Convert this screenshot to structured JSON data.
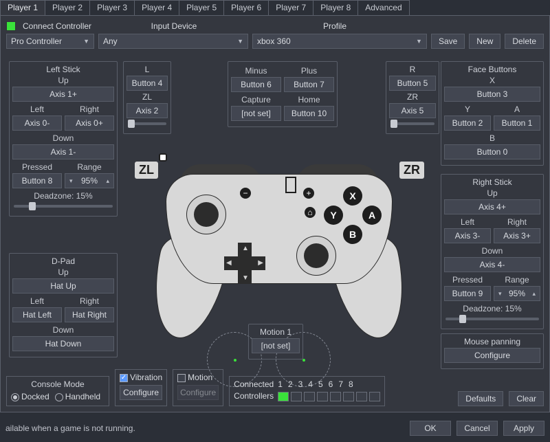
{
  "tabs": [
    "Player 1",
    "Player 2",
    "Player 3",
    "Player 4",
    "Player 5",
    "Player 6",
    "Player 7",
    "Player 8",
    "Advanced"
  ],
  "active_tab": 0,
  "connect_label": "Connect Controller",
  "input_device_label": "Input Device",
  "profile_label": "Profile",
  "controller_type": "Pro Controller",
  "input_device": "Any",
  "profile": "xbox 360",
  "profile_buttons": {
    "save": "Save",
    "new": "New",
    "delete": "Delete"
  },
  "left_stick": {
    "title": "Left Stick",
    "up_label": "Up",
    "up": "Axis 1+",
    "left_label": "Left",
    "left": "Axis 0-",
    "right_label": "Right",
    "right": "Axis 0+",
    "down_label": "Down",
    "down": "Axis 1-",
    "pressed_label": "Pressed",
    "pressed": "Button 8",
    "range_label": "Range",
    "range": "95%",
    "deadzone_label": "Deadzone: 15%"
  },
  "l_group": {
    "l_label": "L",
    "l": "Button 4",
    "zl_label": "ZL",
    "zl": "Axis 2"
  },
  "center_buttons": {
    "minus_label": "Minus",
    "minus": "Button 6",
    "plus_label": "Plus",
    "plus": "Button 7",
    "capture_label": "Capture",
    "capture": "[not set]",
    "home_label": "Home",
    "home": "Button 10"
  },
  "r_group": {
    "r_label": "R",
    "r": "Button 5",
    "zr_label": "ZR",
    "zr": "Axis 5"
  },
  "face": {
    "title": "Face Buttons",
    "x_label": "X",
    "x": "Button 3",
    "y_label": "Y",
    "y": "Button 2",
    "a_label": "A",
    "a": "Button 1",
    "b_label": "B",
    "b": "Button 0"
  },
  "right_stick": {
    "title": "Right Stick",
    "up_label": "Up",
    "up": "Axis 4+",
    "left_label": "Left",
    "left": "Axis 3-",
    "right_label": "Right",
    "right": "Axis 3+",
    "down_label": "Down",
    "down": "Axis 4-",
    "pressed_label": "Pressed",
    "pressed": "Button 9",
    "range_label": "Range",
    "range": "95%",
    "deadzone_label": "Deadzone: 15%"
  },
  "mouse_panning": {
    "title": "Mouse panning",
    "configure": "Configure"
  },
  "dpad": {
    "title": "D-Pad",
    "up_label": "Up",
    "up": "Hat Up",
    "left_label": "Left",
    "left": "Hat Left",
    "right_label": "Right",
    "right": "Hat Right",
    "down_label": "Down",
    "down": "Hat Down"
  },
  "zl_badge": "ZL",
  "zr_badge": "ZR",
  "motion": {
    "title": "Motion 1",
    "bind": "[not set]"
  },
  "console_mode": {
    "title": "Console Mode",
    "docked": "Docked",
    "handheld": "Handheld",
    "selected": "docked"
  },
  "vibration": {
    "label": "Vibration",
    "checked": true,
    "configure": "Configure"
  },
  "motion_chk": {
    "label": "Motion",
    "checked": false,
    "configure": "Configure"
  },
  "connected": {
    "label": "Connected",
    "controllers_label": "Controllers",
    "slots": [
      1,
      2,
      3,
      4,
      5,
      6,
      7,
      8
    ],
    "active": 1
  },
  "defaults": "Defaults",
  "clear": "Clear",
  "status": "ailable when a game is not running.",
  "footer": {
    "ok": "OK",
    "cancel": "Cancel",
    "apply": "Apply"
  },
  "face_icons": {
    "x": "X",
    "y": "Y",
    "a": "A",
    "b": "B"
  }
}
